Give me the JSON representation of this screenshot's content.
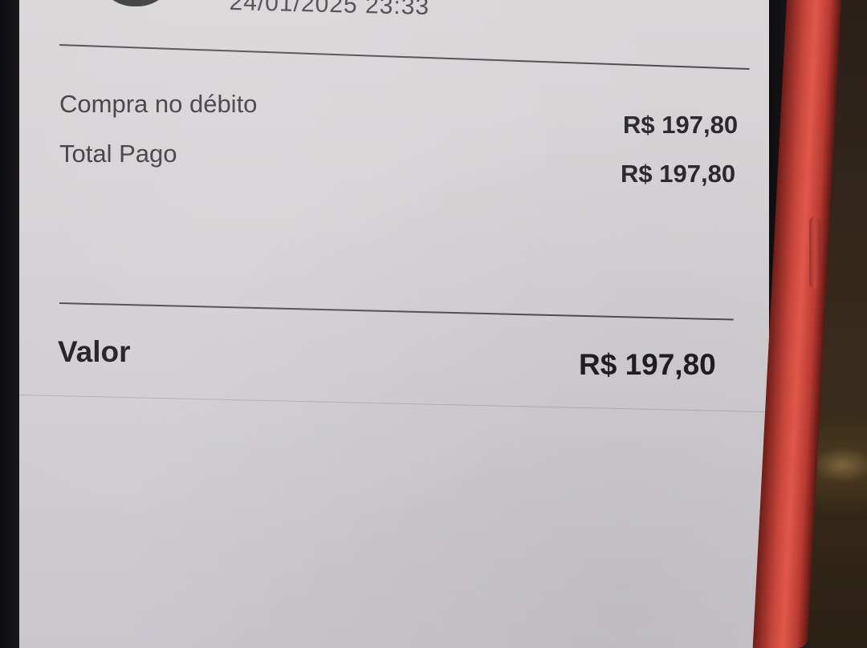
{
  "receipt": {
    "datetime": "24/01/2025 23:33",
    "items": [
      {
        "label": "Compra no débito",
        "amount": "R$ 197,80"
      },
      {
        "label": "Total Pago",
        "amount": "R$ 197,80"
      }
    ],
    "total": {
      "label": "Valor",
      "amount": "R$ 197,80"
    }
  },
  "colors": {
    "case": "#e0584c",
    "screen": "#d6d3d6",
    "text": "#2a292e"
  }
}
